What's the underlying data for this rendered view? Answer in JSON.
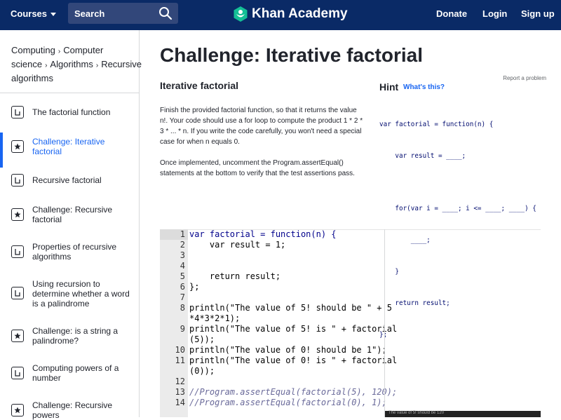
{
  "header": {
    "courses_label": "Courses",
    "search_label": "Search",
    "logo_text": "Khan Academy",
    "donate_label": "Donate",
    "login_label": "Login",
    "signup_label": "Sign up"
  },
  "breadcrumb": {
    "items": [
      "Computing",
      "Computer science",
      "Algorithms",
      "Recursive algorithms"
    ],
    "sep": "›"
  },
  "sidebar": {
    "items": [
      {
        "label": "The factorial function",
        "type": "article-icon"
      },
      {
        "label": "Challenge: Iterative factorial",
        "type": "star-icon",
        "active": true
      },
      {
        "label": "Recursive factorial",
        "type": "article-icon"
      },
      {
        "label": "Challenge: Recursive factorial",
        "type": "star-icon"
      },
      {
        "label": "Properties of recursive algorithms",
        "type": "article-icon"
      },
      {
        "label": "Using recursion to determine whether a word is a palindrome",
        "type": "article-icon"
      },
      {
        "label": "Challenge: is a string a palindrome?",
        "type": "star-icon"
      },
      {
        "label": "Computing powers of a number",
        "type": "article-icon"
      },
      {
        "label": "Challenge: Recursive powers",
        "type": "star-icon"
      }
    ]
  },
  "main": {
    "title": "Challenge: Iterative factorial",
    "report_label": "Report a problem",
    "subtitle": "Iterative factorial",
    "description_1": "Finish the provided factorial function, so that it returns the value n!. Your code should use a for loop to compute the product 1 * 2 * 3 * ... * n. If you write the code carefully, you won't need a special case for when n equals 0.",
    "description_2": "Once implemented, uncomment the Program.assertEqual() statements at the bottom to verify that the test assertions pass.",
    "hint_title": "Hint",
    "hint_link": "What's this?",
    "hint_code": [
      "var factorial = function(n) {",
      "    var result = ____;",
      "",
      "    for(var i = ____; i <= ____; ____) {",
      "        ____;",
      "    }",
      "    return result;",
      "};"
    ]
  },
  "editor": {
    "line_numbers": [
      "1",
      "2",
      "3",
      "4",
      "5",
      "6",
      "7",
      "8",
      "",
      "9",
      "",
      "10",
      "11",
      "",
      "12",
      "13",
      "14"
    ],
    "lines": [
      "var factorial = function(n) {",
      "    var result = 1;",
      "",
      "",
      "    return result;",
      "};",
      "",
      "println(\"The value of 5! should be \" + 5",
      "*4*3*2*1);",
      "println(\"The value of 5! is \" + factorial",
      "(5));",
      "println(\"The value of 0! should be 1\");",
      "println(\"The value of 0! is \" + factorial",
      "(0));",
      "",
      "//Program.assertEqual(factorial(5), 120);",
      "//Program.assertEqual(factorial(0), 1);"
    ],
    "output_text": "The value of 5! should be 120"
  }
}
